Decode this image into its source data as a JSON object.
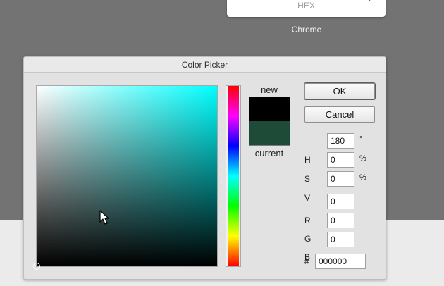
{
  "background": {
    "card_label": "HEX",
    "browser_label": "Chrome"
  },
  "dialog": {
    "title": "Color Picker",
    "swatch_new_label": "new",
    "swatch_current_label": "current",
    "new_color": "#000000",
    "current_color": "#1e4a38",
    "field_hue_color": "#00ffff",
    "ok_label": "OK",
    "cancel_label": "Cancel",
    "fields": [
      {
        "label": "",
        "value": "180",
        "unit": "°"
      },
      {
        "label": "H",
        "value": "0",
        "unit": "%"
      },
      {
        "label": "S",
        "value": "0",
        "unit": "%"
      },
      {
        "label": "V",
        "value": "0",
        "unit": ""
      },
      {
        "label": "R",
        "value": "0",
        "unit": ""
      },
      {
        "label": "G",
        "value": "0",
        "unit": ""
      },
      {
        "label": "B",
        "value": "",
        "unit": ""
      }
    ],
    "hex_prefix": "#",
    "hex_value": "000000"
  }
}
